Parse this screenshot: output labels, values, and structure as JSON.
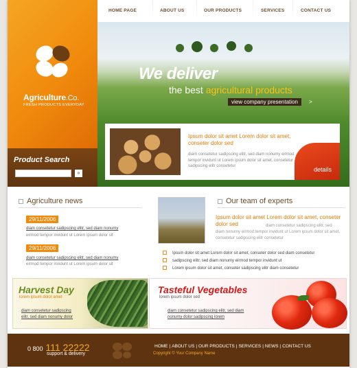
{
  "brand": {
    "name": "Agriculture",
    "name_suffix": ".Co.",
    "tagline": "FRESH PRODUCTS EVERYDAY"
  },
  "search": {
    "title": "Product Search",
    "button": "»"
  },
  "nav": [
    "HOME PAGE",
    "ABOUT US",
    "OUR PRODUCTS",
    "SERVICES",
    "CONTACT US"
  ],
  "hero": {
    "headline": "We deliver",
    "subline_prefix": "the best",
    "subline_highlight": "agricultural products",
    "button": "view company presentation",
    "button_suffix": ">"
  },
  "feature": {
    "title": "Ipsum dolor sit amet Lorem dolor sit amet, conseter dolor sed",
    "text": "diam consetetur sadipscing elitr, sed diam nonumy eirmod tempor invidunt ut Lorem ipsum dolor sit amet, consetetur sadipscing elitr consetetur",
    "details": "details"
  },
  "news": {
    "title": "Agriculture news",
    "items": [
      {
        "date": "29/11/2006",
        "link": "diam consetetur sadipscing elitr, sed diam nonumy",
        "text": "eirmod tempor invidunt ut Lorem ipsum dolor sit"
      },
      {
        "date": "29/11/2006",
        "link": "diam consetetur sadipscing elitr, sed diam nonumy",
        "text": "eirmod tempor invidunt ut Lorem ipsum dolor sit"
      }
    ]
  },
  "team": {
    "title": "Our team of experts",
    "lead": "Ipsum dolor sit amet Lorem dolor sit amet, conseter dolor sed",
    "text": "diam consetetur sadipscing elitr, sed",
    "text2": "diam nonumy eirmod tempor invidunt ut Lorem ipsum dolor sit amet, consetetur sadipscing elitr consetetur",
    "list": [
      "Ipsum dolor sit amet Lorem dolor sit amet, conseter dolor sed diam consetetur",
      "sadipscing elitr, sed diam nonumy eirmod tempor invidunt ut",
      "Lorem ipsum dolor sit amet, conseter sadipscing elitr diam consetetur"
    ]
  },
  "promo_harvest": {
    "title": "Harvest Day",
    "subtitle": "lorem ipsum dolor amet",
    "link_line1": "diam consetetur sadipscing",
    "link_line2": "elitr, sed diam nonumy dolor"
  },
  "promo_veg": {
    "title": "Tasteful Vegetables",
    "subtitle": "lorem ipsum dolor sed",
    "link_line1": "diam consetetur sadipscing elitr, sed diam",
    "link_line2": "nonumy dolor sadipscing lorem"
  },
  "footer": {
    "phone_prefix": "0 800",
    "phone_number": "111 22222",
    "support": "support & delivery",
    "links": [
      "HOME",
      "ABOUT US",
      "OUR PRODUCTS",
      "SERVICES",
      "NEWS",
      "CONTACT US"
    ],
    "copyright": "Copyright © Your Company Name"
  },
  "colors": {
    "orange": "#f08a0c",
    "brown": "#5e3410",
    "green": "#6a8b1e",
    "red": "#d11a1a"
  }
}
